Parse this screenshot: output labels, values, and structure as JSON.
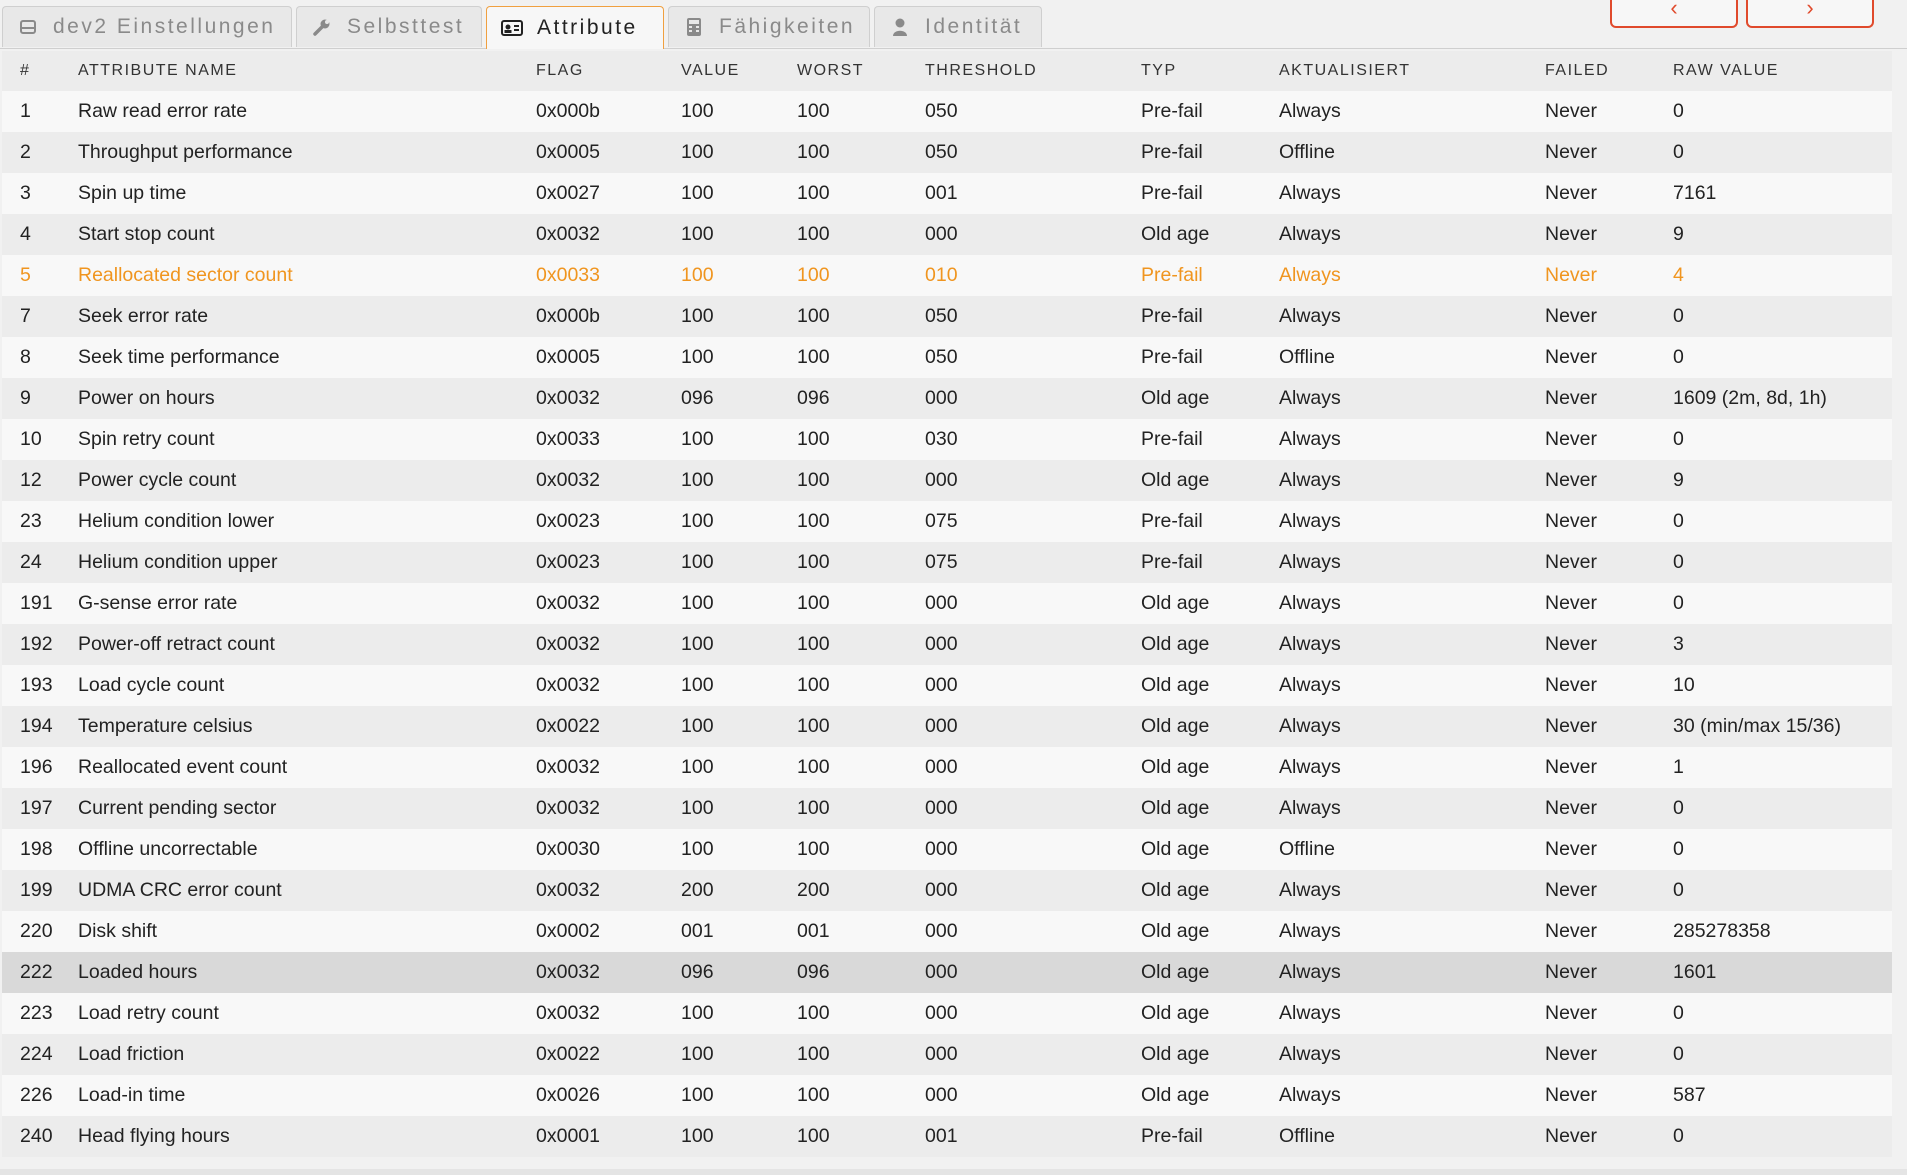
{
  "tabs": [
    {
      "label": "dev2 Einstellungen",
      "icon": "hdd-icon"
    },
    {
      "label": "Selbsttest",
      "icon": "wrench-icon"
    },
    {
      "label": "Attribute",
      "icon": "id-card-icon"
    },
    {
      "label": "Fähigkeiten",
      "icon": "calculator-icon"
    },
    {
      "label": "Identität",
      "icon": "user-icon"
    }
  ],
  "active_tab": "Attribute",
  "nav": {
    "prev_icon": "‹",
    "next_icon": "›"
  },
  "colors": {
    "accent": "#f0a040",
    "nav": "#e04a2c",
    "warning": "#f0951f"
  },
  "table": {
    "headers": [
      "#",
      "ATTRIBUTE NAME",
      "FLAG",
      "VALUE",
      "WORST",
      "THRESHOLD",
      "TYP",
      "AKTUALISIERT",
      "FAILED",
      "RAW VALUE"
    ],
    "rows": [
      [
        "1",
        "Raw read error rate",
        "0x000b",
        "100",
        "100",
        "050",
        "Pre-fail",
        "Always",
        "Never",
        "0"
      ],
      [
        "2",
        "Throughput performance",
        "0x0005",
        "100",
        "100",
        "050",
        "Pre-fail",
        "Offline",
        "Never",
        "0"
      ],
      [
        "3",
        "Spin up time",
        "0x0027",
        "100",
        "100",
        "001",
        "Pre-fail",
        "Always",
        "Never",
        "7161"
      ],
      [
        "4",
        "Start stop count",
        "0x0032",
        "100",
        "100",
        "000",
        "Old age",
        "Always",
        "Never",
        "9"
      ],
      [
        "5",
        "Reallocated sector count",
        "0x0033",
        "100",
        "100",
        "010",
        "Pre-fail",
        "Always",
        "Never",
        "4"
      ],
      [
        "7",
        "Seek error rate",
        "0x000b",
        "100",
        "100",
        "050",
        "Pre-fail",
        "Always",
        "Never",
        "0"
      ],
      [
        "8",
        "Seek time performance",
        "0x0005",
        "100",
        "100",
        "050",
        "Pre-fail",
        "Offline",
        "Never",
        "0"
      ],
      [
        "9",
        "Power on hours",
        "0x0032",
        "096",
        "096",
        "000",
        "Old age",
        "Always",
        "Never",
        "1609 (2m, 8d, 1h)"
      ],
      [
        "10",
        "Spin retry count",
        "0x0033",
        "100",
        "100",
        "030",
        "Pre-fail",
        "Always",
        "Never",
        "0"
      ],
      [
        "12",
        "Power cycle count",
        "0x0032",
        "100",
        "100",
        "000",
        "Old age",
        "Always",
        "Never",
        "9"
      ],
      [
        "23",
        "Helium condition lower",
        "0x0023",
        "100",
        "100",
        "075",
        "Pre-fail",
        "Always",
        "Never",
        "0"
      ],
      [
        "24",
        "Helium condition upper",
        "0x0023",
        "100",
        "100",
        "075",
        "Pre-fail",
        "Always",
        "Never",
        "0"
      ],
      [
        "191",
        "G-sense error rate",
        "0x0032",
        "100",
        "100",
        "000",
        "Old age",
        "Always",
        "Never",
        "0"
      ],
      [
        "192",
        "Power-off retract count",
        "0x0032",
        "100",
        "100",
        "000",
        "Old age",
        "Always",
        "Never",
        "3"
      ],
      [
        "193",
        "Load cycle count",
        "0x0032",
        "100",
        "100",
        "000",
        "Old age",
        "Always",
        "Never",
        "10"
      ],
      [
        "194",
        "Temperature celsius",
        "0x0022",
        "100",
        "100",
        "000",
        "Old age",
        "Always",
        "Never",
        "30 (min/max 15/36)"
      ],
      [
        "196",
        "Reallocated event count",
        "0x0032",
        "100",
        "100",
        "000",
        "Old age",
        "Always",
        "Never",
        "1"
      ],
      [
        "197",
        "Current pending sector",
        "0x0032",
        "100",
        "100",
        "000",
        "Old age",
        "Always",
        "Never",
        "0"
      ],
      [
        "198",
        "Offline uncorrectable",
        "0x0030",
        "100",
        "100",
        "000",
        "Old age",
        "Offline",
        "Never",
        "0"
      ],
      [
        "199",
        "UDMA CRC error count",
        "0x0032",
        "200",
        "200",
        "000",
        "Old age",
        "Always",
        "Never",
        "0"
      ],
      [
        "220",
        "Disk shift",
        "0x0002",
        "001",
        "001",
        "000",
        "Old age",
        "Always",
        "Never",
        "285278358"
      ],
      [
        "222",
        "Loaded hours",
        "0x0032",
        "096",
        "096",
        "000",
        "Old age",
        "Always",
        "Never",
        "1601"
      ],
      [
        "223",
        "Load retry count",
        "0x0032",
        "100",
        "100",
        "000",
        "Old age",
        "Always",
        "Never",
        "0"
      ],
      [
        "224",
        "Load friction",
        "0x0022",
        "100",
        "100",
        "000",
        "Old age",
        "Always",
        "Never",
        "0"
      ],
      [
        "226",
        "Load-in time",
        "0x0026",
        "100",
        "100",
        "000",
        "Old age",
        "Always",
        "Never",
        "587"
      ],
      [
        "240",
        "Head flying hours",
        "0x0001",
        "100",
        "100",
        "001",
        "Pre-fail",
        "Offline",
        "Never",
        "0"
      ]
    ],
    "warning_row": "5",
    "hovered_row": "222"
  }
}
